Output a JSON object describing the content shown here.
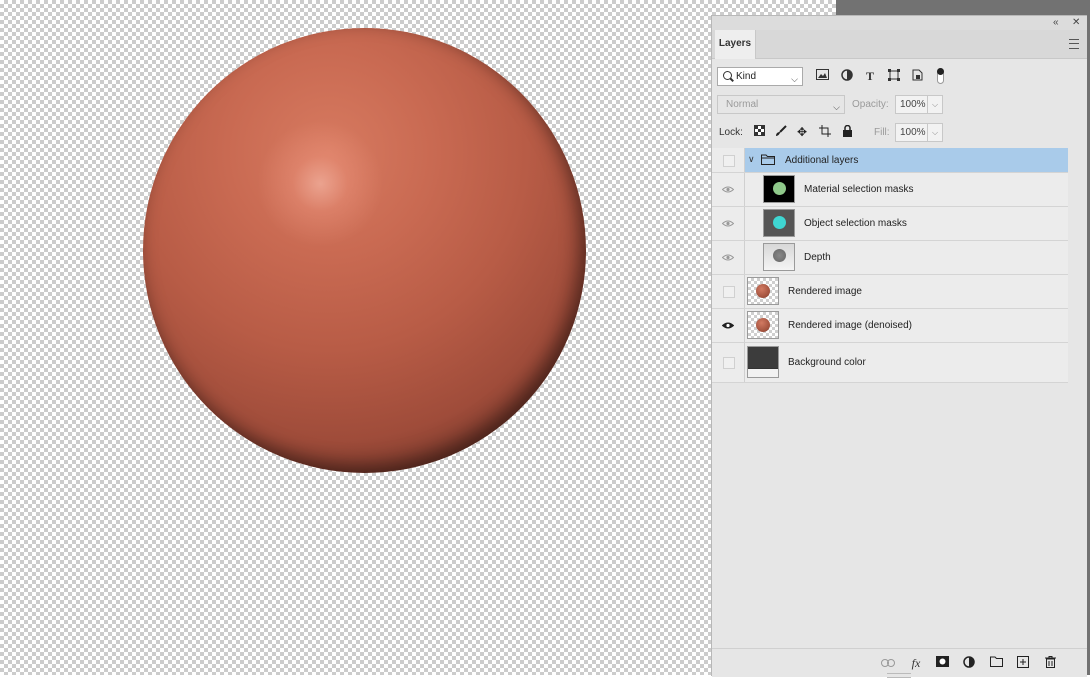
{
  "panel": {
    "tab_label": "Layers",
    "collapse_icon": "double-chevron-left",
    "close_icon": "close-x",
    "menu_icon": "hamburger-menu"
  },
  "filter": {
    "kind_label": "Kind",
    "icons": [
      "pixel-layer-filter-icon",
      "adjustment-layer-filter-icon",
      "type-layer-filter-icon",
      "shape-layer-filter-icon",
      "smart-object-filter-icon"
    ]
  },
  "blend": {
    "mode": "Normal",
    "opacity_label": "Opacity:",
    "opacity_value": "100%"
  },
  "lock": {
    "label": "Lock:",
    "fill_label": "Fill:",
    "fill_value": "100%",
    "icons": [
      "lock-transparent-pixels-icon",
      "lock-image-pixels-icon",
      "lock-position-icon",
      "lock-artboard-icon",
      "lock-all-icon"
    ]
  },
  "layers": [
    {
      "name": "Additional layers",
      "type": "group",
      "visible": false,
      "selected": true
    },
    {
      "name": "Material selection masks",
      "type": "child",
      "visible": true
    },
    {
      "name": "Object selection masks",
      "type": "child",
      "visible": true
    },
    {
      "name": "Depth",
      "type": "child",
      "visible": true
    },
    {
      "name": "Rendered image",
      "type": "layer",
      "visible": false
    },
    {
      "name": "Rendered image (denoised)",
      "type": "layer",
      "visible": true
    },
    {
      "name": "Background color",
      "type": "fill",
      "visible": false
    }
  ],
  "footer_icons": [
    "link-layers-icon",
    "fx-icon",
    "add-mask-icon",
    "adjustment-layer-icon",
    "new-group-icon",
    "new-layer-icon",
    "trash-icon"
  ],
  "colors": {
    "sphere": "#c0634c",
    "selected_row": "#a9cbea",
    "material_mask_dot": "#8fc98a",
    "object_mask_dot": "#3fd6d2"
  }
}
